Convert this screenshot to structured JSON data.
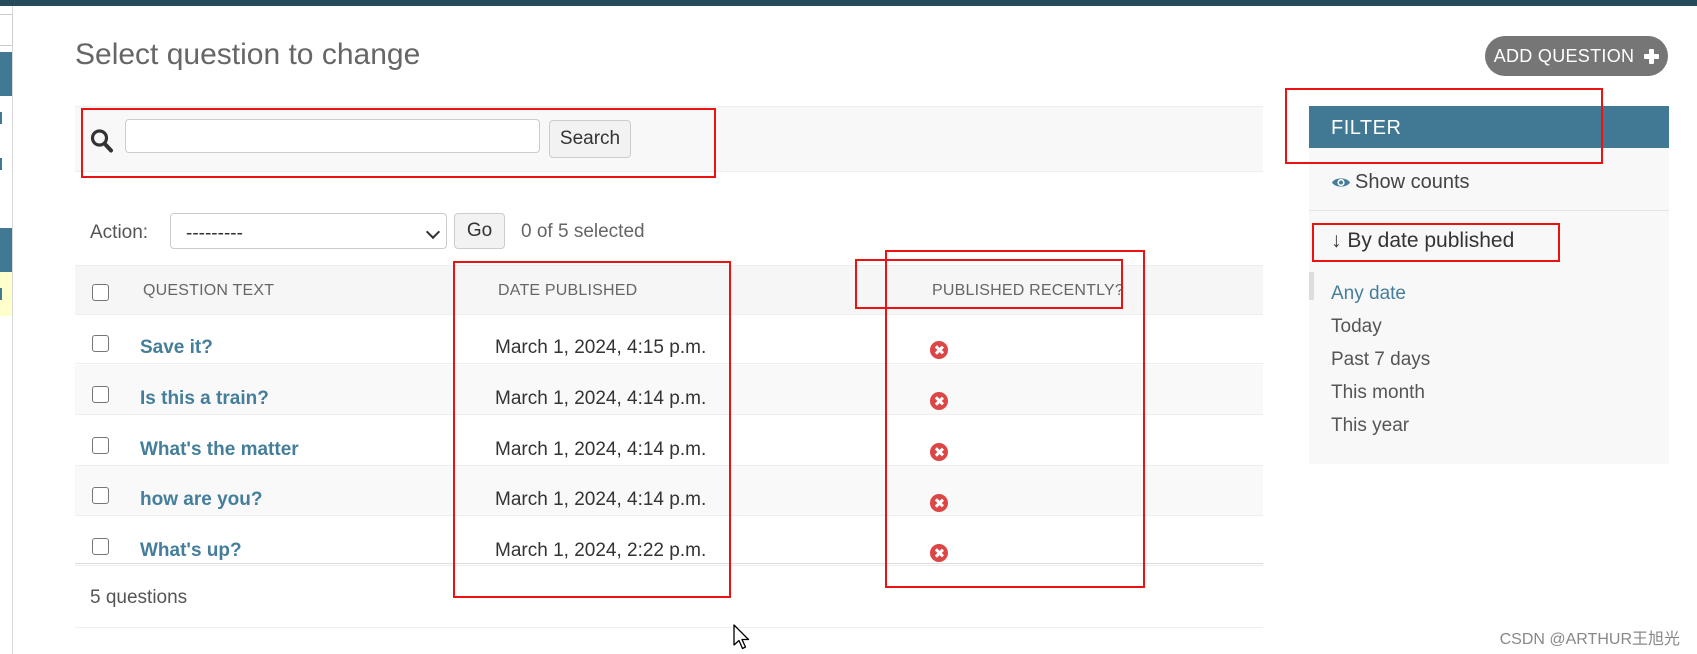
{
  "page": {
    "title": "Select question to change",
    "add_button": "ADD QUESTION"
  },
  "search": {
    "placeholder": "",
    "button": "Search"
  },
  "actions": {
    "label": "Action:",
    "selected_option": "---------",
    "go_button": "Go",
    "selection_count": "0 of 5 selected"
  },
  "table": {
    "headers": [
      "QUESTION TEXT",
      "DATE PUBLISHED",
      "PUBLISHED RECENTLY?"
    ],
    "rows": [
      {
        "question": "Save it?",
        "date": "March 1, 2024, 4:15 p.m.",
        "recent_icon": "false-x-icon"
      },
      {
        "question": "Is this a train?",
        "date": "March 1, 2024, 4:14 p.m.",
        "recent_icon": "false-x-icon"
      },
      {
        "question": "What's the matter",
        "date": "March 1, 2024, 4:14 p.m.",
        "recent_icon": "false-x-icon"
      },
      {
        "question": "how are you?",
        "date": "March 1, 2024, 4:14 p.m.",
        "recent_icon": "false-x-icon"
      },
      {
        "question": "What's up?",
        "date": "March 1, 2024, 2:22 p.m.",
        "recent_icon": "false-x-icon"
      }
    ],
    "footer": "5 questions"
  },
  "filter": {
    "header": "FILTER",
    "show_counts": "Show counts",
    "section_title": "↓ By date published",
    "choices": [
      "Any date",
      "Today",
      "Past 7 days",
      "This month",
      "This year"
    ],
    "selected_choice": "Any date"
  },
  "watermark": "CSDN @ARTHUR王旭光",
  "colors": {
    "header_bar": "#264b5d",
    "filter_header": "#417893",
    "link": "#447e9b",
    "false_icon": "#dd4646",
    "annotation": "#ee1111"
  }
}
